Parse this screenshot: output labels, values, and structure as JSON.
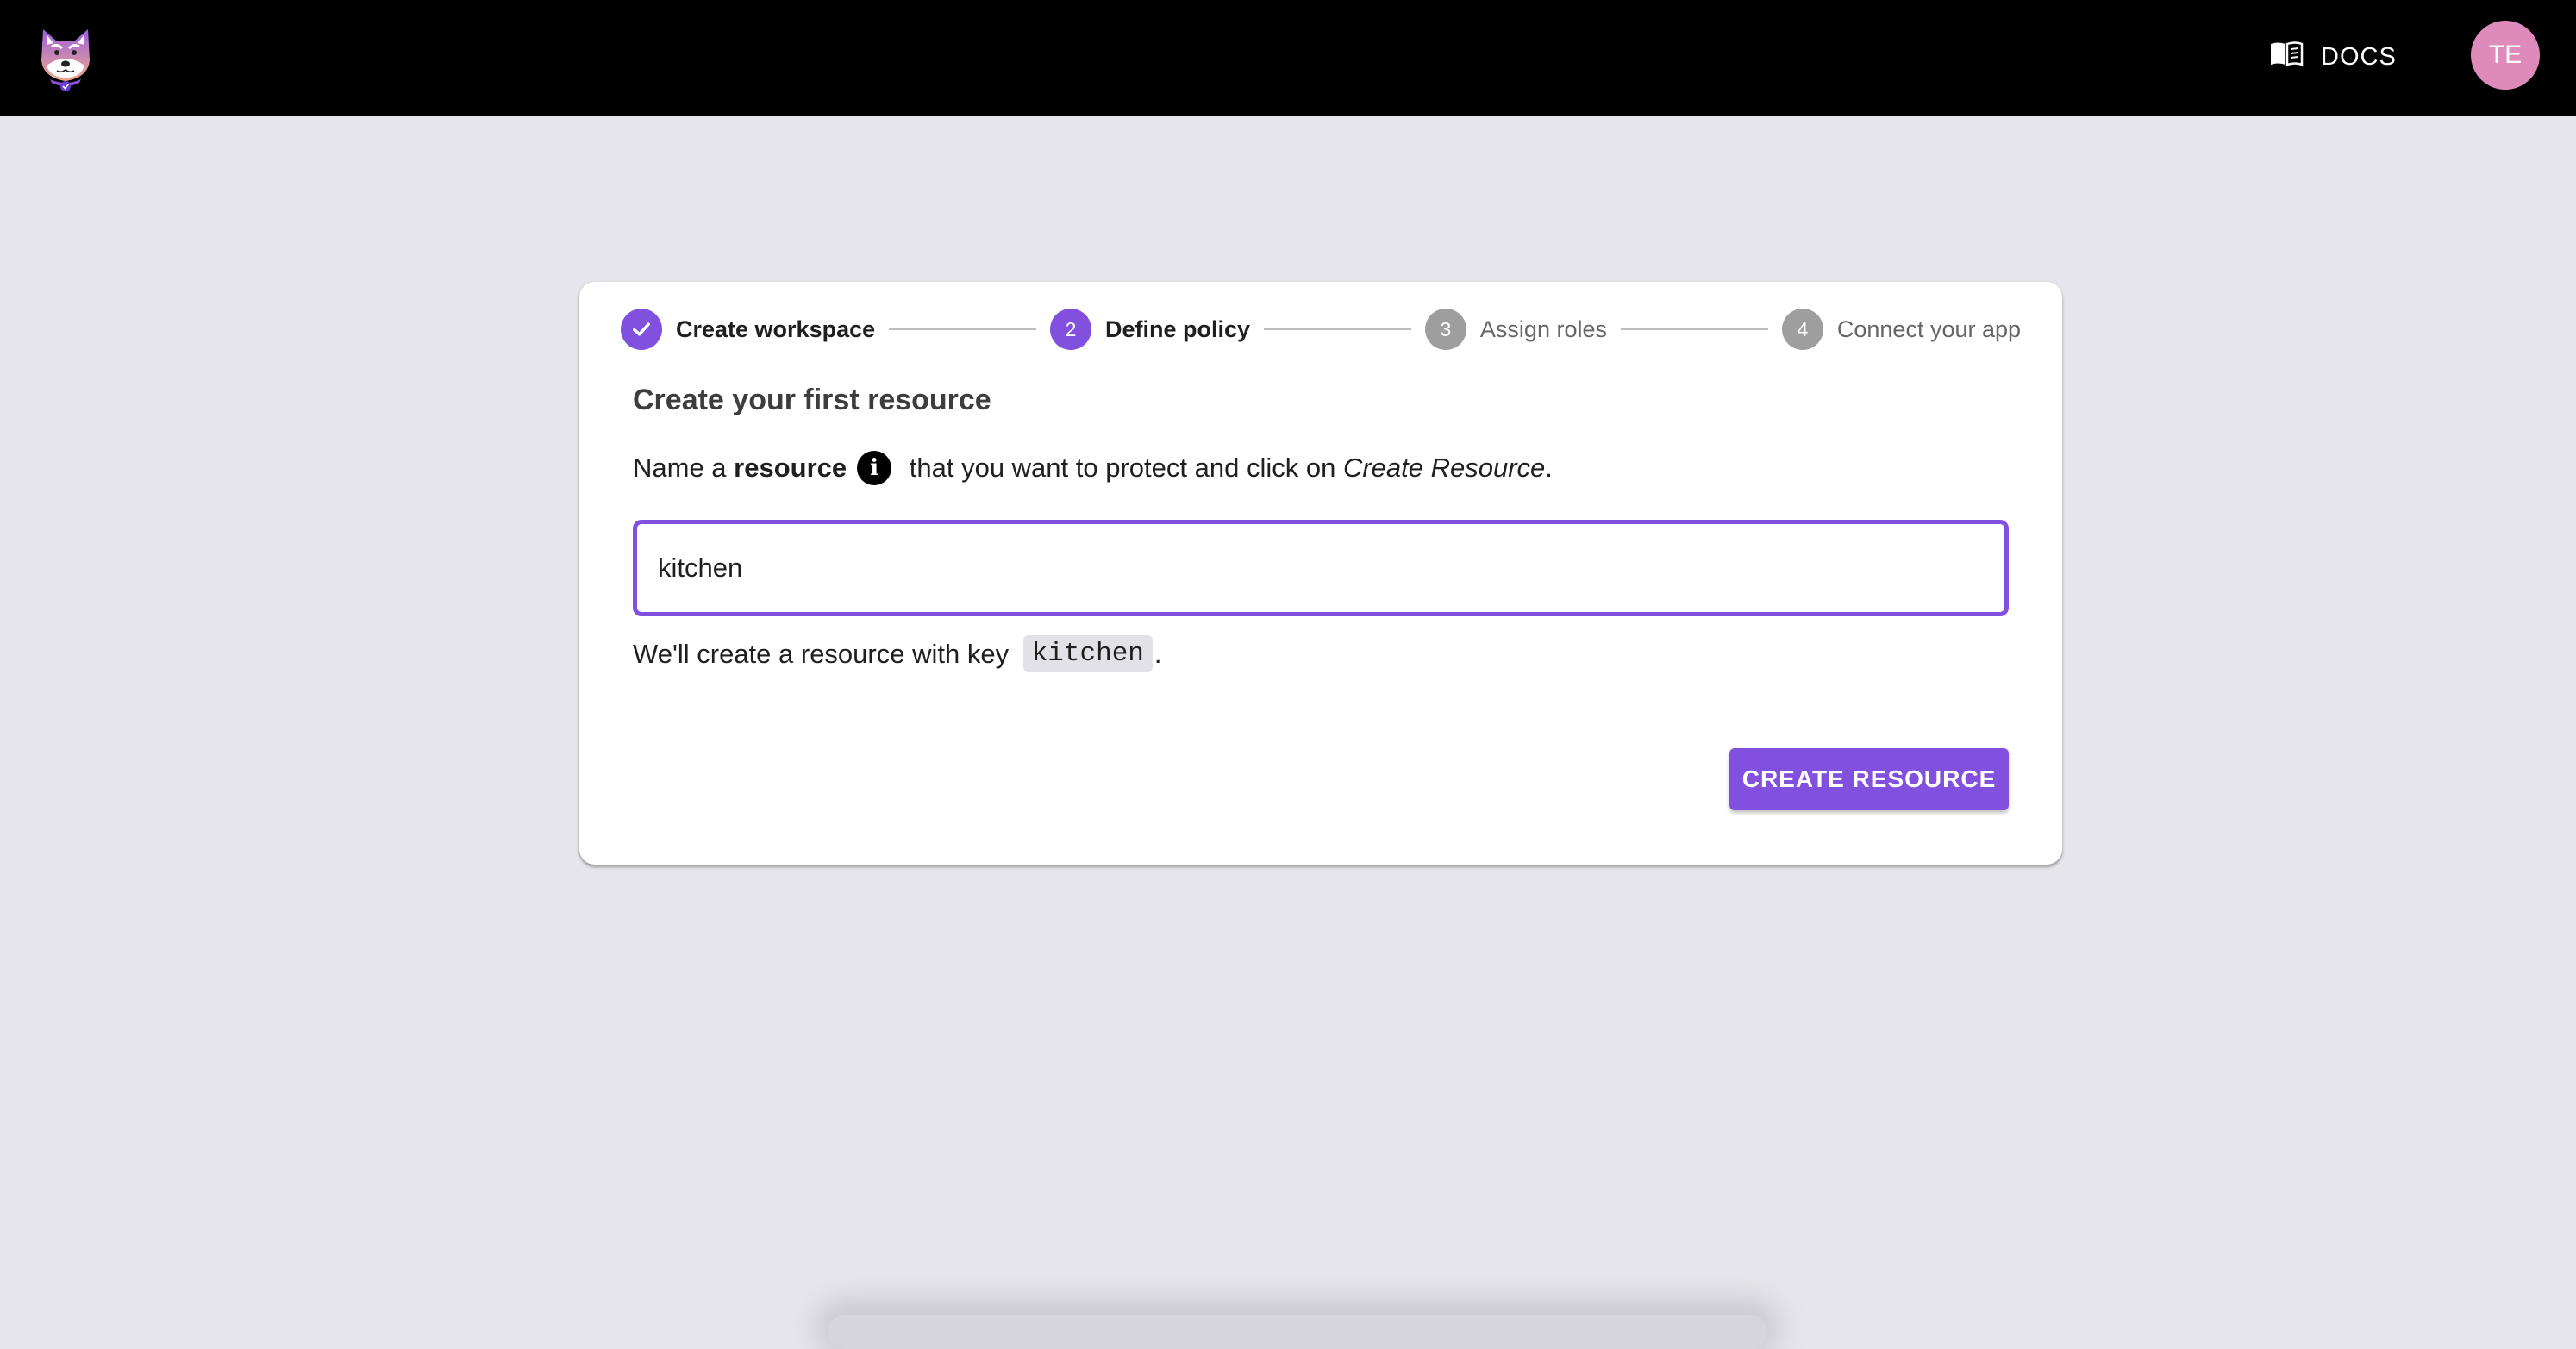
{
  "header": {
    "logo_alt": "dog-logo",
    "docs_label": "DOCS",
    "docs_icon": "book-icon",
    "avatar_initials": "TE",
    "avatar_color": "#de8bbc"
  },
  "stepper": {
    "steps": [
      {
        "index": "1",
        "label": "Create workspace",
        "state": "completed"
      },
      {
        "index": "2",
        "label": "Define policy",
        "state": "active"
      },
      {
        "index": "3",
        "label": "Assign roles",
        "state": "pending"
      },
      {
        "index": "4",
        "label": "Connect your app",
        "state": "pending"
      }
    ]
  },
  "card": {
    "title": "Create your first resource",
    "instruction": {
      "prefix": "Name a ",
      "bold": "resource",
      "middle": " that you want to protect and click on ",
      "italic": "Create Resource",
      "suffix": "."
    },
    "resource_input": {
      "value": "kitchen",
      "placeholder": ""
    },
    "key_line": {
      "prefix": "We'll create a resource with key ",
      "key": "kitchen",
      "suffix": "."
    },
    "create_button_label": "CREATE RESOURCE"
  },
  "colors": {
    "accent": "#8250df",
    "pending_step": "#9e9e9e",
    "background": "#e6e5eb",
    "topbar": "#000000"
  }
}
